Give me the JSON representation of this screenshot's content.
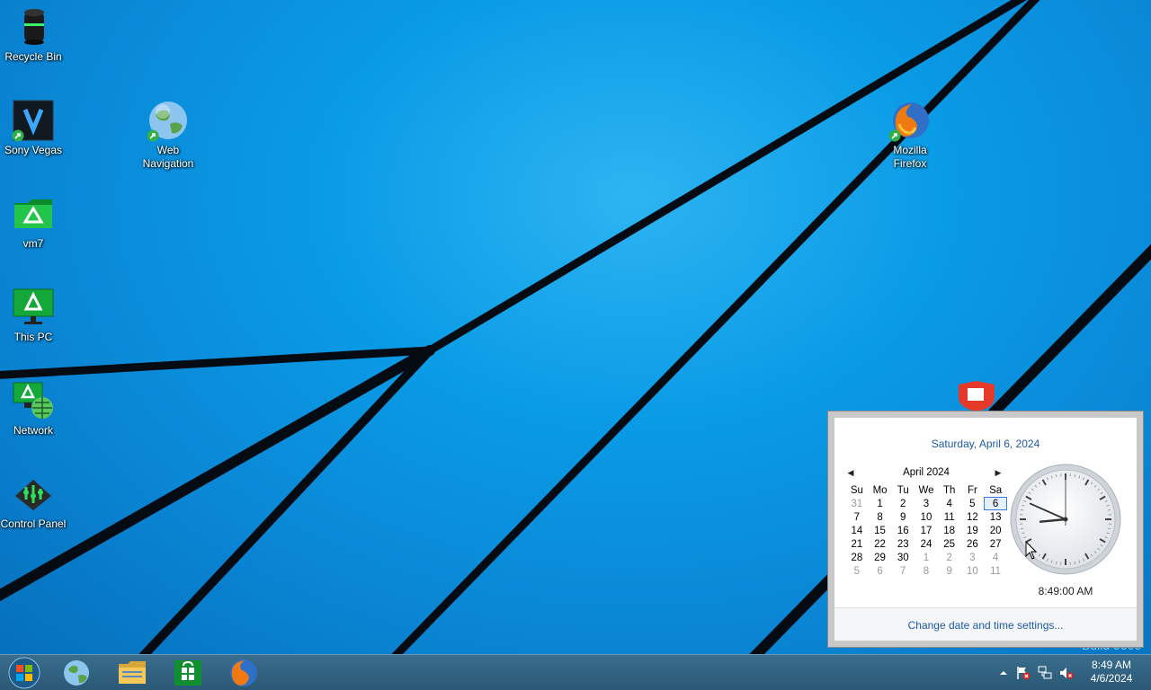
{
  "desktop": {
    "icons": [
      {
        "label": "Recycle Bin",
        "icon": "recycle-bin-icon"
      },
      {
        "label": "Sony Vegas",
        "icon": "sony-vegas-icon"
      },
      {
        "label": "Web Navigation",
        "icon": "globe-icon"
      },
      {
        "label": "Mozilla Firefox",
        "icon": "firefox-icon"
      },
      {
        "label": "vm7",
        "icon": "folder-icon"
      },
      {
        "label": "This PC",
        "icon": "computer-icon"
      },
      {
        "label": "Network",
        "icon": "network-icon"
      },
      {
        "label": "Control Panel",
        "icon": "control-panel-icon"
      }
    ],
    "watermark": "Build 9600"
  },
  "taskbar": {
    "pinned": [
      "start-orb",
      "internet-explorer",
      "file-explorer",
      "store",
      "firefox"
    ],
    "clock": {
      "time": "8:49 AM",
      "date": "4/6/2024"
    }
  },
  "flyout": {
    "long_date": "Saturday, April 6, 2024",
    "month_label": "April 2024",
    "weekdays": [
      "Su",
      "Mo",
      "Tu",
      "We",
      "Th",
      "Fr",
      "Sa"
    ],
    "weeks": [
      [
        "31",
        "1",
        "2",
        "3",
        "4",
        "5",
        "6"
      ],
      [
        "7",
        "8",
        "9",
        "10",
        "11",
        "12",
        "13"
      ],
      [
        "14",
        "15",
        "16",
        "17",
        "18",
        "19",
        "20"
      ],
      [
        "21",
        "22",
        "23",
        "24",
        "25",
        "26",
        "27"
      ],
      [
        "28",
        "29",
        "30",
        "1",
        "2",
        "3",
        "4"
      ],
      [
        "5",
        "6",
        "7",
        "8",
        "9",
        "10",
        "11"
      ]
    ],
    "today": "6",
    "time_text": "8:49:00 AM",
    "analog_time": {
      "hours": 8,
      "minutes": 49,
      "seconds": 0
    },
    "change_link": "Change date and time settings..."
  },
  "colors": {
    "accent": "#1e5aa8",
    "desktop": "#0a9be6",
    "taskbar": "#2f5f7e"
  }
}
